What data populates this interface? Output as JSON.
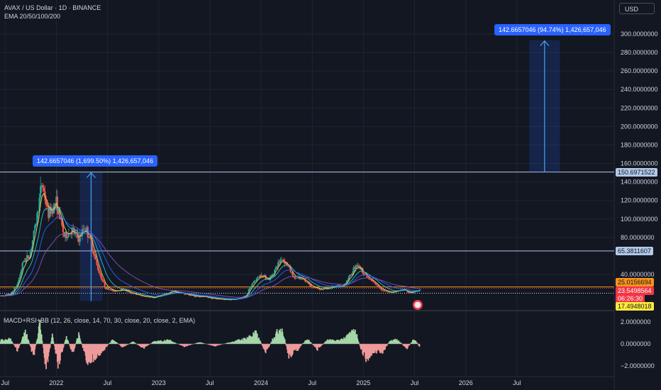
{
  "header": {
    "symbol": "AVAX / US Dollar · 1D · BINANCE",
    "indicator": "EMA 20/50/100/200"
  },
  "currency": "USD",
  "measure_labels": [
    {
      "text": "142.6657046 (1,699.50%) 1,426,657,046"
    },
    {
      "text": "142.6657046 (94.74%) 1,426,657,046"
    }
  ],
  "price_tags": [
    {
      "text": "150.6971522",
      "value": 150.6971522,
      "bg": "#b2c9e8",
      "fg": "#131722"
    },
    {
      "text": "65.3811607",
      "value": 65.3811607,
      "bg": "#b2c9e8",
      "fg": "#131722"
    },
    {
      "text": "25.0156694",
      "value": 25.0156694,
      "bg": "#f7931a",
      "fg": "#131722"
    },
    {
      "text": "23.5498564",
      "value": 23.5498564,
      "bg": "#f23645",
      "fg": "#ffffff"
    },
    {
      "text": "06:26:30",
      "value": 20.4,
      "bg": "#f23645",
      "fg": "#ffffff"
    },
    {
      "text": "17.4948018",
      "value": 17.4948018,
      "bg": "#ffeb3b",
      "fg": "#131722"
    }
  ],
  "macd_label": "MACD+RSI+BB (12, 26, close, 14, 70, 30, close, 20, close, 2, EMA)",
  "colors": {
    "background": "#131722",
    "grid": "#1f2430",
    "axis_text": "#d1d4dc",
    "up": "#26a69a",
    "down": "#ef5350",
    "measure": "#2962ff",
    "level_line": "#b2c9e8",
    "hist_pos": "#a5d6a7",
    "hist_neg": "#ef9a9a"
  },
  "chart_data": [
    {
      "type": "candlestick",
      "title": "AVAX / US Dollar · 1D · BINANCE",
      "ylim": [
        0,
        310
      ],
      "y_ticks": [
        {
          "value": 300,
          "label": "300.0000000"
        },
        {
          "value": 280,
          "label": "280.0000000"
        },
        {
          "value": 260,
          "label": "260.0000000"
        },
        {
          "value": 240,
          "label": "240.0000000"
        },
        {
          "value": 220,
          "label": "220.0000000"
        },
        {
          "value": 200,
          "label": "200.0000000"
        },
        {
          "value": 180,
          "label": "180.0000000"
        },
        {
          "value": 160,
          "label": "160.0000000"
        },
        {
          "value": 140,
          "label": "140.0000000"
        },
        {
          "value": 120,
          "label": "120.0000000"
        },
        {
          "value": 100,
          "label": "100.0000000"
        },
        {
          "value": 80,
          "label": "80.0000000"
        },
        {
          "value": 40,
          "label": "40.0000000"
        }
      ],
      "x_ticks": [
        {
          "t": 2021.5,
          "label": "Jul"
        },
        {
          "t": 2022.0,
          "label": "2022"
        },
        {
          "t": 2022.5,
          "label": "Jul"
        },
        {
          "t": 2023.0,
          "label": "2023"
        },
        {
          "t": 2023.5,
          "label": "Jul"
        },
        {
          "t": 2024.0,
          "label": "2024"
        },
        {
          "t": 2024.5,
          "label": "Jul"
        },
        {
          "t": 2025.0,
          "label": "2025"
        },
        {
          "t": 2025.5,
          "label": "Jul"
        },
        {
          "t": 2026.0,
          "label": "2026"
        },
        {
          "t": 2026.5,
          "label": "Jul"
        }
      ],
      "xlim": [
        2021.45,
        2027.45
      ],
      "price_path": [
        [
          2021.45,
          14
        ],
        [
          2021.55,
          16
        ],
        [
          2021.62,
          28
        ],
        [
          2021.68,
          55
        ],
        [
          2021.74,
          60
        ],
        [
          2021.8,
          95
        ],
        [
          2021.86,
          140
        ],
        [
          2021.92,
          105
        ],
        [
          2022.0,
          118
        ],
        [
          2022.08,
          80
        ],
        [
          2022.15,
          88
        ],
        [
          2022.22,
          78
        ],
        [
          2022.28,
          92
        ],
        [
          2022.34,
          75
        ],
        [
          2022.4,
          48
        ],
        [
          2022.48,
          24
        ],
        [
          2022.56,
          20
        ],
        [
          2022.65,
          22
        ],
        [
          2022.75,
          17
        ],
        [
          2022.85,
          14
        ],
        [
          2022.95,
          12
        ],
        [
          2023.05,
          16
        ],
        [
          2023.15,
          20
        ],
        [
          2023.25,
          17
        ],
        [
          2023.35,
          14
        ],
        [
          2023.45,
          13
        ],
        [
          2023.55,
          11
        ],
        [
          2023.65,
          10
        ],
        [
          2023.75,
          10
        ],
        [
          2023.85,
          14
        ],
        [
          2023.92,
          30
        ],
        [
          2024.0,
          40
        ],
        [
          2024.08,
          34
        ],
        [
          2024.13,
          44
        ],
        [
          2024.2,
          58
        ],
        [
          2024.26,
          50
        ],
        [
          2024.32,
          36
        ],
        [
          2024.42,
          34
        ],
        [
          2024.5,
          25
        ],
        [
          2024.6,
          22
        ],
        [
          2024.7,
          25
        ],
        [
          2024.8,
          26
        ],
        [
          2024.88,
          40
        ],
        [
          2024.93,
          52
        ],
        [
          2024.98,
          45
        ],
        [
          2025.05,
          35
        ],
        [
          2025.12,
          28
        ],
        [
          2025.18,
          22
        ],
        [
          2025.25,
          18
        ],
        [
          2025.32,
          20
        ],
        [
          2025.4,
          22
        ],
        [
          2025.45,
          17.5
        ],
        [
          2025.52,
          20
        ],
        [
          2025.56,
          23.5
        ]
      ],
      "ema_lines": [
        {
          "name": "EMA 20",
          "color": "#f7d04f"
        },
        {
          "name": "EMA 50",
          "color": "#26c6da"
        },
        {
          "name": "EMA 100",
          "color": "#2962ff"
        },
        {
          "name": "EMA 200",
          "color": "#7e57c2"
        }
      ],
      "horizontal_levels": [
        150.6971522,
        65.3811607,
        25.0156694,
        23.5498564,
        17.4948018
      ],
      "measures": [
        {
          "t0": 2022.23,
          "t1": 2022.45,
          "from": 8,
          "to": 150.6971522
        },
        {
          "t0": 2026.62,
          "t1": 2026.92,
          "from": 150.6971522,
          "to": 293.3628568
        }
      ]
    },
    {
      "type": "bar",
      "title": "MACD+RSI+BB (12, 26, close, 14, 70, 30, close, 20, close, 2, EMA)",
      "ylim": [
        -2.8,
        2.8
      ],
      "y_ticks": [
        {
          "value": 2,
          "label": "2.0000000"
        },
        {
          "value": 0,
          "label": "0.0000000"
        },
        {
          "value": -2,
          "label": "−2.0000000"
        }
      ],
      "hist_path": [
        [
          2021.45,
          0.3
        ],
        [
          2021.55,
          0.5
        ],
        [
          2021.62,
          -0.6
        ],
        [
          2021.7,
          1.1
        ],
        [
          2021.78,
          -1.2
        ],
        [
          2021.84,
          1.9
        ],
        [
          2021.9,
          -2.3
        ],
        [
          2021.96,
          0.8
        ],
        [
          2022.02,
          -1.9
        ],
        [
          2022.1,
          0.7
        ],
        [
          2022.16,
          -0.9
        ],
        [
          2022.22,
          0.9
        ],
        [
          2022.3,
          -1.6
        ],
        [
          2022.36,
          -1.3
        ],
        [
          2022.45,
          -0.7
        ],
        [
          2022.55,
          0.4
        ],
        [
          2022.65,
          -0.3
        ],
        [
          2022.75,
          0.2
        ],
        [
          2022.85,
          -0.4
        ],
        [
          2022.95,
          0.2
        ],
        [
          2023.1,
          0.35
        ],
        [
          2023.25,
          -0.25
        ],
        [
          2023.4,
          0.15
        ],
        [
          2023.55,
          -0.2
        ],
        [
          2023.7,
          0.15
        ],
        [
          2023.85,
          0.5
        ],
        [
          2023.95,
          1.0
        ],
        [
          2024.05,
          -0.8
        ],
        [
          2024.12,
          0.6
        ],
        [
          2024.2,
          1.6
        ],
        [
          2024.27,
          -1.1
        ],
        [
          2024.35,
          -0.6
        ],
        [
          2024.45,
          0.5
        ],
        [
          2024.55,
          -0.5
        ],
        [
          2024.65,
          0.35
        ],
        [
          2024.75,
          0.3
        ],
        [
          2024.85,
          0.7
        ],
        [
          2024.92,
          1.3
        ],
        [
          2024.98,
          -0.6
        ],
        [
          2025.04,
          -1.5
        ],
        [
          2025.1,
          -0.7
        ],
        [
          2025.18,
          -0.9
        ],
        [
          2025.26,
          0.3
        ],
        [
          2025.34,
          0.4
        ],
        [
          2025.42,
          -0.45
        ],
        [
          2025.5,
          0.5
        ],
        [
          2025.55,
          -0.3
        ]
      ]
    }
  ]
}
